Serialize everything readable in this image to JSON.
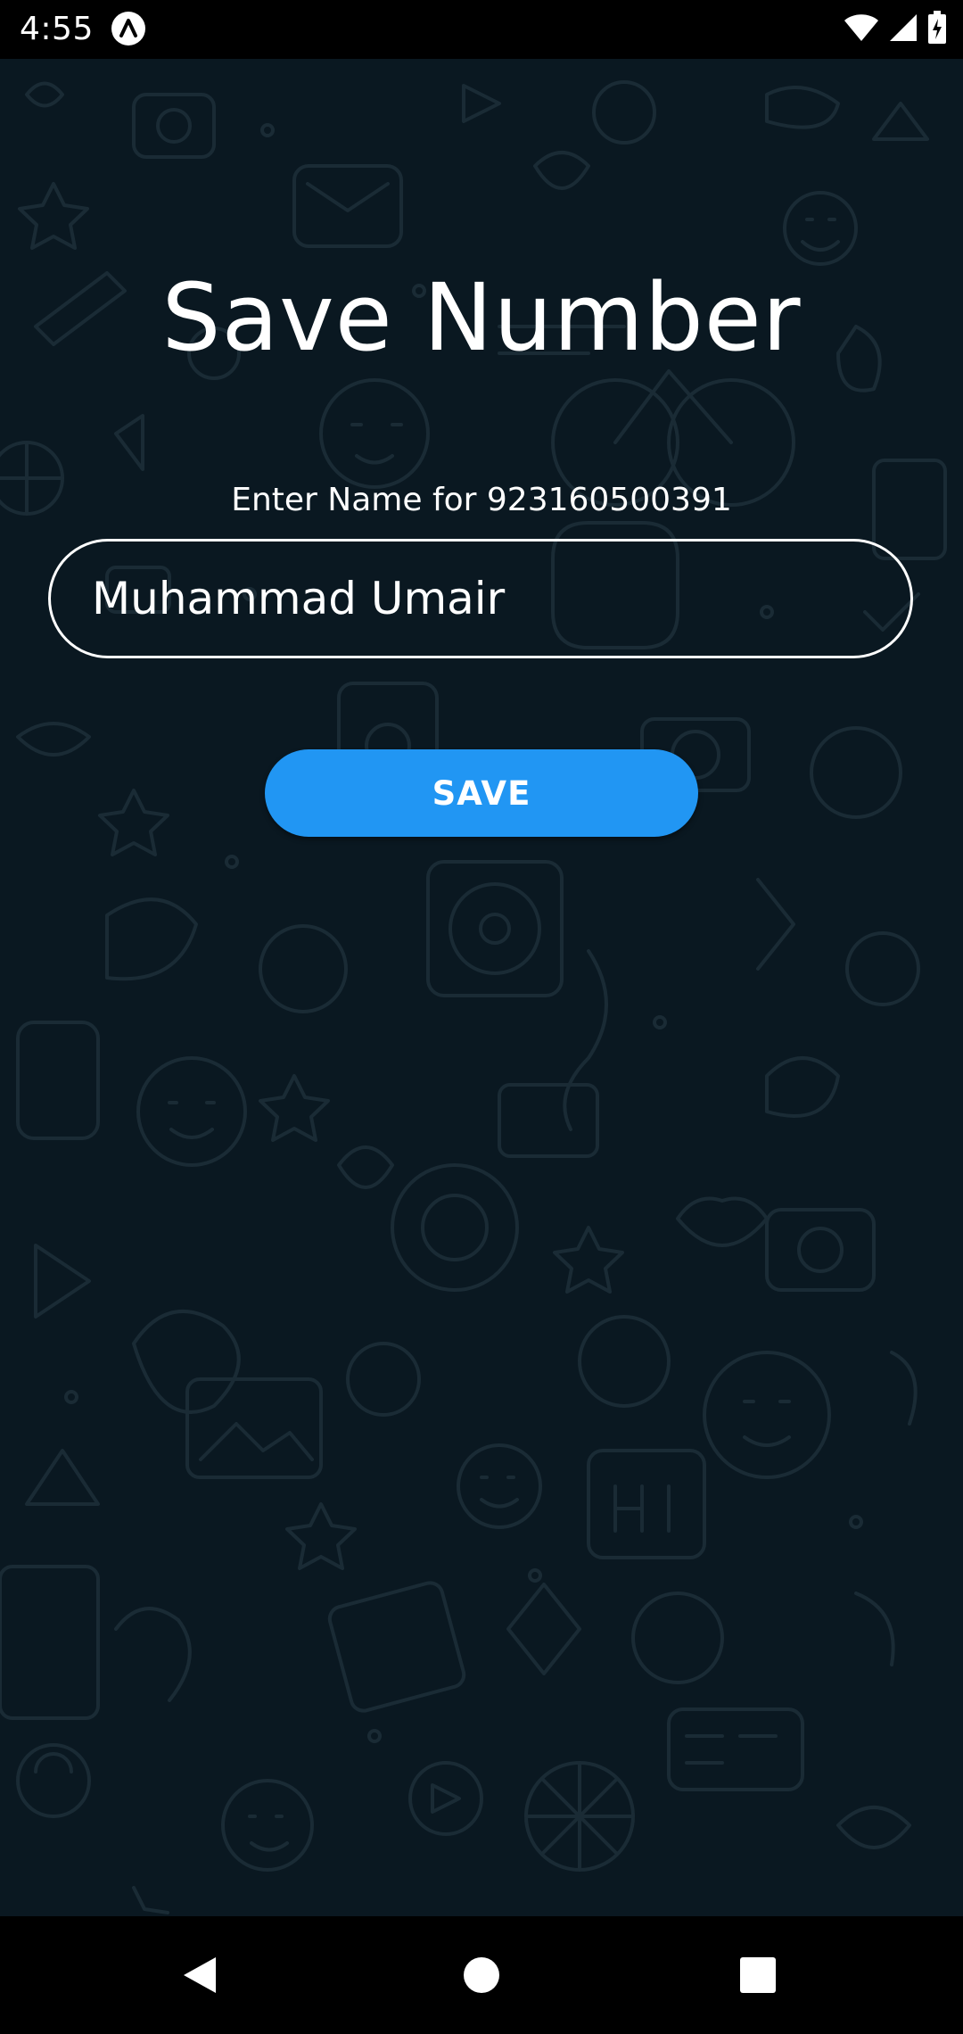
{
  "status_bar": {
    "time": "4:55",
    "app_icon": "app-notification-icon",
    "icons": [
      "wifi-icon",
      "signal-icon",
      "battery-charging-icon"
    ]
  },
  "background": {
    "color": "#0a1821",
    "pattern": "doodle-wallpaper"
  },
  "page": {
    "title": "Save Number",
    "label": "Enter Name for 923160500391",
    "input_value": "Muhammad Umair",
    "save_label": "SAVE",
    "accent_color": "#2196f3"
  },
  "nav_bar": {
    "icons": [
      "back-icon",
      "home-icon",
      "recents-icon"
    ]
  }
}
